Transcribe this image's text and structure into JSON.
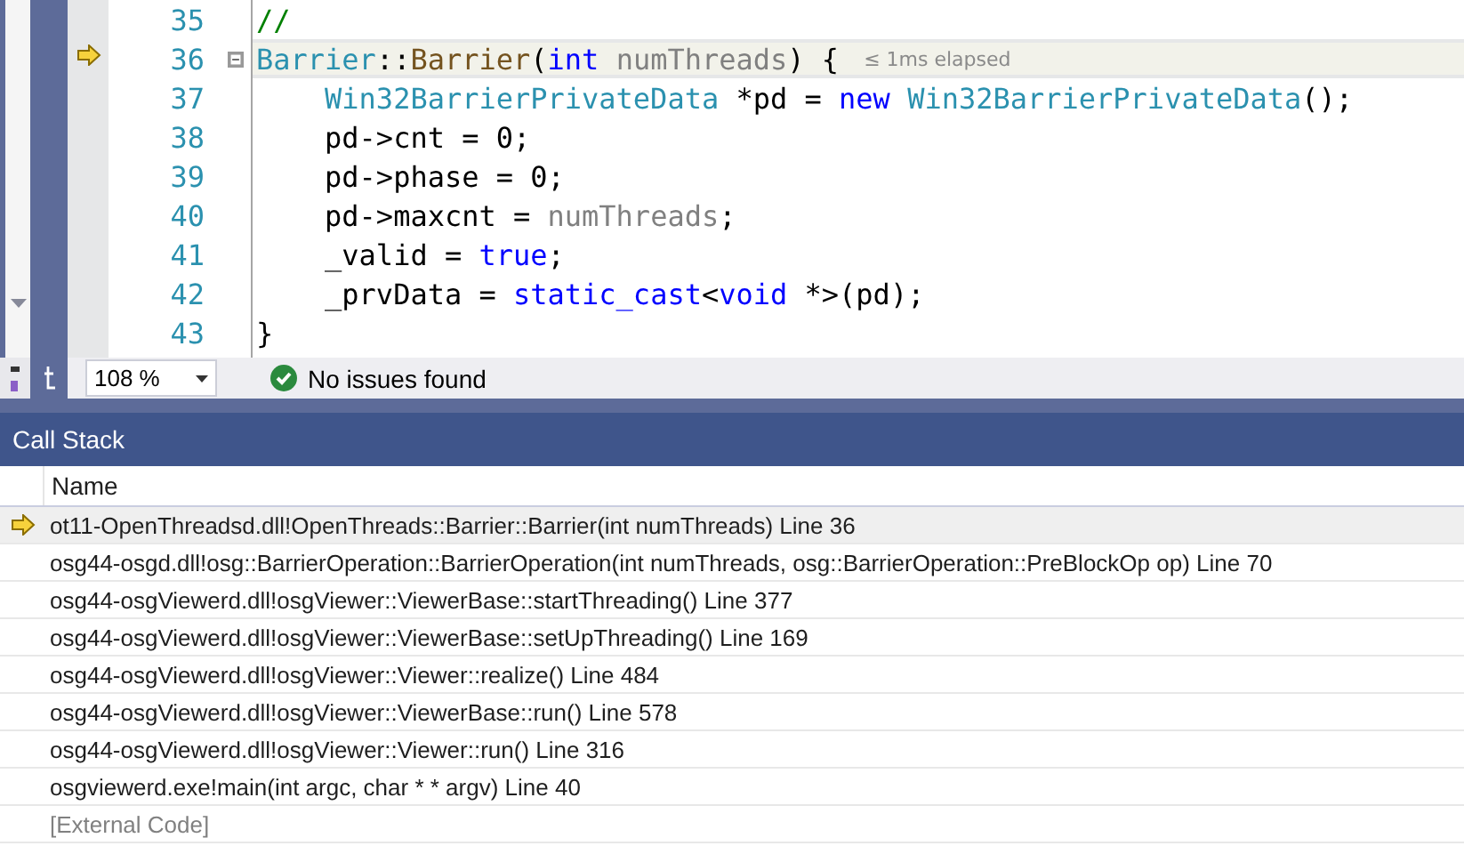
{
  "editor": {
    "lines": [
      {
        "number": "35",
        "current": false,
        "foldable": false,
        "tokens": [
          {
            "text": "//",
            "kind": "comment"
          }
        ]
      },
      {
        "number": "36",
        "current": true,
        "foldable": true,
        "hint": "≤ 1ms elapsed",
        "tokens": [
          {
            "text": "Barrier",
            "kind": "type"
          },
          {
            "text": "::",
            "kind": "plain"
          },
          {
            "text": "Barrier",
            "kind": "func"
          },
          {
            "text": "(",
            "kind": "plain"
          },
          {
            "text": "int",
            "kind": "keyword"
          },
          {
            "text": " numThreads",
            "kind": "param"
          },
          {
            "text": ") {",
            "kind": "plain"
          }
        ]
      },
      {
        "number": "37",
        "current": false,
        "foldable": false,
        "tokens": [
          {
            "text": "    Win32BarrierPrivateData",
            "kind": "type"
          },
          {
            "text": " *pd = ",
            "kind": "plain"
          },
          {
            "text": "new",
            "kind": "keyword"
          },
          {
            "text": " Win32BarrierPrivateData",
            "kind": "type"
          },
          {
            "text": "();",
            "kind": "plain"
          }
        ]
      },
      {
        "number": "38",
        "current": false,
        "foldable": false,
        "tokens": [
          {
            "text": "    pd->cnt = 0;",
            "kind": "plain"
          }
        ]
      },
      {
        "number": "39",
        "current": false,
        "foldable": false,
        "tokens": [
          {
            "text": "    pd->phase = 0;",
            "kind": "plain"
          }
        ]
      },
      {
        "number": "40",
        "current": false,
        "foldable": false,
        "tokens": [
          {
            "text": "    pd->maxcnt = ",
            "kind": "plain"
          },
          {
            "text": "numThreads",
            "kind": "param"
          },
          {
            "text": ";",
            "kind": "plain"
          }
        ]
      },
      {
        "number": "41",
        "current": false,
        "foldable": false,
        "tokens": [
          {
            "text": "    _valid = ",
            "kind": "plain"
          },
          {
            "text": "true",
            "kind": "keyword"
          },
          {
            "text": ";",
            "kind": "plain"
          }
        ]
      },
      {
        "number": "42",
        "current": false,
        "foldable": false,
        "tokens": [
          {
            "text": "    _prvData = ",
            "kind": "plain"
          },
          {
            "text": "static_cast",
            "kind": "keyword"
          },
          {
            "text": "<",
            "kind": "plain"
          },
          {
            "text": "void",
            "kind": "keyword"
          },
          {
            "text": " *>(pd);",
            "kind": "plain"
          }
        ]
      },
      {
        "number": "43",
        "current": false,
        "foldable": false,
        "tokens": [
          {
            "text": "}",
            "kind": "plain"
          }
        ]
      }
    ]
  },
  "status_bar": {
    "zoom": "108 %",
    "issues": "No issues found"
  },
  "call_stack": {
    "title": "Call Stack",
    "columns": [
      "Name"
    ],
    "rows": [
      {
        "name": "ot11-OpenThreadsd.dll!OpenThreads::Barrier::Barrier(int numThreads) Line 36",
        "current": true,
        "kind": "frame"
      },
      {
        "name": "osg44-osgd.dll!osg::BarrierOperation::BarrierOperation(int numThreads, osg::BarrierOperation::PreBlockOp op) Line 70",
        "current": false,
        "kind": "frame"
      },
      {
        "name": "osg44-osgViewerd.dll!osgViewer::ViewerBase::startThreading() Line 377",
        "current": false,
        "kind": "frame"
      },
      {
        "name": "osg44-osgViewerd.dll!osgViewer::ViewerBase::setUpThreading() Line 169",
        "current": false,
        "kind": "frame"
      },
      {
        "name": "osg44-osgViewerd.dll!osgViewer::Viewer::realize() Line 484",
        "current": false,
        "kind": "frame"
      },
      {
        "name": "osg44-osgViewerd.dll!osgViewer::ViewerBase::run() Line 578",
        "current": false,
        "kind": "frame"
      },
      {
        "name": "osg44-osgViewerd.dll!osgViewer::Viewer::run() Line 316",
        "current": false,
        "kind": "frame"
      },
      {
        "name": "osgviewerd.exe!main(int argc, char * * argv) Line 40",
        "current": false,
        "kind": "frame"
      },
      {
        "name": "[External Code]",
        "current": false,
        "kind": "external"
      }
    ]
  }
}
